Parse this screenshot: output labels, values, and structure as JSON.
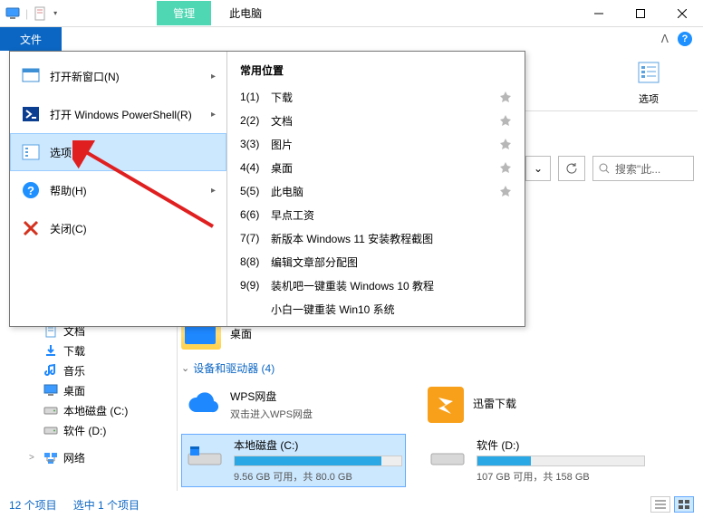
{
  "titlebar": {
    "ribbon_tab": "管理",
    "title": "此电脑"
  },
  "file_tab": "文件",
  "options_btn": "选项",
  "file_menu": {
    "items": [
      {
        "label": "打开新窗口(N)",
        "icon": "new-window",
        "has_submenu": true
      },
      {
        "label": "打开 Windows PowerShell(R)",
        "icon": "powershell",
        "has_submenu": true
      },
      {
        "label": "选项",
        "icon": "options",
        "has_submenu": false,
        "hovered": true
      },
      {
        "label": "帮助(H)",
        "icon": "help",
        "has_submenu": true
      },
      {
        "label": "关闭(C)",
        "icon": "close",
        "has_submenu": false
      }
    ],
    "right_header": "常用位置",
    "right_items": [
      {
        "num": "1(1)",
        "label": "下载",
        "pinned": true
      },
      {
        "num": "2(2)",
        "label": "文档",
        "pinned": true
      },
      {
        "num": "3(3)",
        "label": "图片",
        "pinned": true
      },
      {
        "num": "4(4)",
        "label": "桌面",
        "pinned": true
      },
      {
        "num": "5(5)",
        "label": "此电脑",
        "pinned": true
      },
      {
        "num": "6(6)",
        "label": "早点工资",
        "pinned": false
      },
      {
        "num": "7(7)",
        "label": "新版本 Windows 11 安装教程截图",
        "pinned": false
      },
      {
        "num": "8(8)",
        "label": "编辑文章部分配图",
        "pinned": false
      },
      {
        "num": "9(9)",
        "label": "装机吧一键重装 Windows 10 教程",
        "pinned": false
      },
      {
        "num": "",
        "label": "小白一键重装 Win10 系统",
        "pinned": false
      }
    ]
  },
  "search": {
    "placeholder": "搜索\"此..."
  },
  "nav_tree": [
    {
      "label": "文档",
      "icon": "doc"
    },
    {
      "label": "下载",
      "icon": "download"
    },
    {
      "label": "音乐",
      "icon": "music"
    },
    {
      "label": "桌面",
      "icon": "desktop"
    },
    {
      "label": "本地磁盘 (C:)",
      "icon": "drive"
    },
    {
      "label": "软件 (D:)",
      "icon": "drive"
    }
  ],
  "nav_network": "网络",
  "content": {
    "desktop_label": "桌面",
    "section_header": "设备和驱动器 (4)",
    "wps": {
      "name": "WPS网盘",
      "sub": "双击进入WPS网盘"
    },
    "xunlei": {
      "name": "迅雷下载"
    },
    "c_drive": {
      "name": "本地磁盘 (C:)",
      "status": "9.56 GB 可用，共 80.0 GB",
      "fill": 88
    },
    "d_drive": {
      "name": "软件 (D:)",
      "status": "107 GB 可用，共 158 GB",
      "fill": 32
    }
  },
  "statusbar": {
    "count": "12 个项目",
    "selection": "选中 1 个项目"
  }
}
